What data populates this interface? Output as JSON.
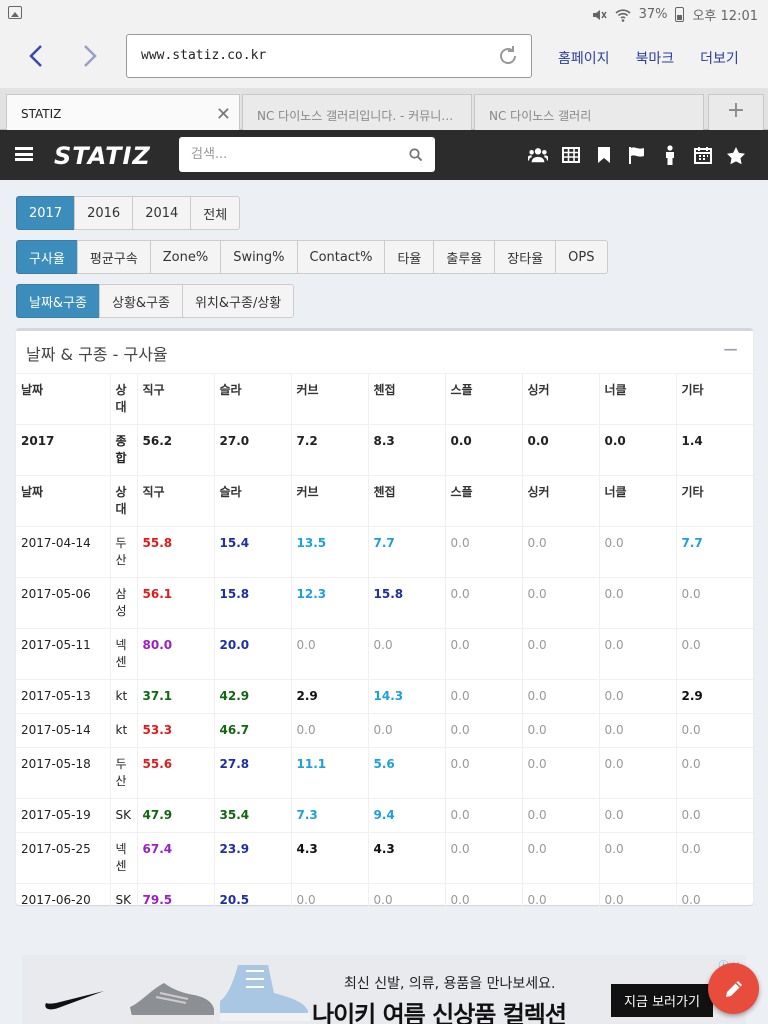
{
  "status_bar": {
    "battery": "37%",
    "time": "오후 12:01"
  },
  "browser": {
    "url": "www.statiz.co.kr",
    "links": [
      "홈페이지",
      "북마크",
      "더보기"
    ],
    "tabs": [
      {
        "title": "STATIZ"
      },
      {
        "title": "NC 다이노스 갤러리입니다. - 커뮤니…"
      },
      {
        "title": "NC 다이노스 갤러리"
      }
    ],
    "new_tab": "+"
  },
  "header": {
    "logo": "STATIZ",
    "search_placeholder": "검색...",
    "icons": [
      "users-icon",
      "table-icon",
      "bookmark-icon",
      "flag-icon",
      "person-icon",
      "calendar-icon",
      "star-icon"
    ]
  },
  "year_tabs": [
    "2017",
    "2016",
    "2014",
    "전체"
  ],
  "year_selected": "2017",
  "stat_tabs": [
    "구사율",
    "평균구속",
    "Zone%",
    "Swing%",
    "Contact%",
    "타율",
    "출루율",
    "장타율",
    "OPS"
  ],
  "stat_selected": "구사율",
  "split_tabs": [
    "날짜&구종",
    "상황&구종",
    "위치&구종/상황"
  ],
  "split_selected": "날짜&구종",
  "box": {
    "title": "날짜 & 구종 - 구사율",
    "collapse": "−"
  },
  "table": {
    "headers": [
      "날짜",
      "상대",
      "직구",
      "슬라",
      "커브",
      "첸접",
      "스플",
      "싱커",
      "너클",
      "기타"
    ],
    "summary": [
      "2017",
      "종합",
      "56.2",
      "27.0",
      "7.2",
      "8.3",
      "0.0",
      "0.0",
      "0.0",
      "1.4"
    ],
    "rows": [
      {
        "cells": [
          "2017-04-14",
          "두산",
          "55.8",
          "15.4",
          "13.5",
          "7.7",
          "0.0",
          "0.0",
          "0.0",
          "7.7"
        ],
        "colors": [
          "",
          "",
          "c-red",
          "c-navy",
          "c-blue",
          "c-blue",
          "c-gray",
          "c-gray",
          "c-gray",
          "c-blue"
        ]
      },
      {
        "cells": [
          "2017-05-06",
          "삼성",
          "56.1",
          "15.8",
          "12.3",
          "15.8",
          "0.0",
          "0.0",
          "0.0",
          "0.0"
        ],
        "colors": [
          "",
          "",
          "c-red",
          "c-navy",
          "c-blue",
          "c-navy",
          "c-gray",
          "c-gray",
          "c-gray",
          "c-gray"
        ]
      },
      {
        "cells": [
          "2017-05-11",
          "넥센",
          "80.0",
          "20.0",
          "0.0",
          "0.0",
          "0.0",
          "0.0",
          "0.0",
          "0.0"
        ],
        "colors": [
          "",
          "",
          "c-purple",
          "c-navy",
          "c-gray",
          "c-gray",
          "c-gray",
          "c-gray",
          "c-gray",
          "c-gray"
        ]
      },
      {
        "cells": [
          "2017-05-13",
          "kt",
          "37.1",
          "42.9",
          "2.9",
          "14.3",
          "0.0",
          "0.0",
          "0.0",
          "2.9"
        ],
        "colors": [
          "",
          "",
          "c-green",
          "c-green",
          "c-black",
          "c-blue",
          "c-gray",
          "c-gray",
          "c-gray",
          "c-black"
        ]
      },
      {
        "cells": [
          "2017-05-14",
          "kt",
          "53.3",
          "46.7",
          "0.0",
          "0.0",
          "0.0",
          "0.0",
          "0.0",
          "0.0"
        ],
        "colors": [
          "",
          "",
          "c-red",
          "c-green",
          "c-gray",
          "c-gray",
          "c-gray",
          "c-gray",
          "c-gray",
          "c-gray"
        ]
      },
      {
        "cells": [
          "2017-05-18",
          "두산",
          "55.6",
          "27.8",
          "11.1",
          "5.6",
          "0.0",
          "0.0",
          "0.0",
          "0.0"
        ],
        "colors": [
          "",
          "",
          "c-red",
          "c-navy",
          "c-blue",
          "c-blue",
          "c-gray",
          "c-gray",
          "c-gray",
          "c-gray"
        ]
      },
      {
        "cells": [
          "2017-05-19",
          "SK",
          "47.9",
          "35.4",
          "7.3",
          "9.4",
          "0.0",
          "0.0",
          "0.0",
          "0.0"
        ],
        "colors": [
          "",
          "",
          "c-green",
          "c-green",
          "c-blue",
          "c-blue",
          "c-gray",
          "c-gray",
          "c-gray",
          "c-gray"
        ]
      },
      {
        "cells": [
          "2017-05-25",
          "넥센",
          "67.4",
          "23.9",
          "4.3",
          "4.3",
          "0.0",
          "0.0",
          "0.0",
          "0.0"
        ],
        "colors": [
          "",
          "",
          "c-purple",
          "c-navy",
          "c-black",
          "c-black",
          "c-gray",
          "c-gray",
          "c-gray",
          "c-gray"
        ]
      },
      {
        "cells": [
          "2017-06-20",
          "SK",
          "79.5",
          "20.5",
          "0.0",
          "0.0",
          "0.0",
          "0.0",
          "0.0",
          "0.0"
        ],
        "colors": [
          "",
          "",
          "c-purple",
          "c-navy",
          "c-gray",
          "c-gray",
          "c-gray",
          "c-gray",
          "c-gray",
          "c-gray"
        ]
      }
    ]
  },
  "ad": {
    "line1": "최신 신발, 의류, 용품을 만나보세요.",
    "line2": "나이키 여름 신상품 컬렉션",
    "cta": "지금 보러가기"
  }
}
